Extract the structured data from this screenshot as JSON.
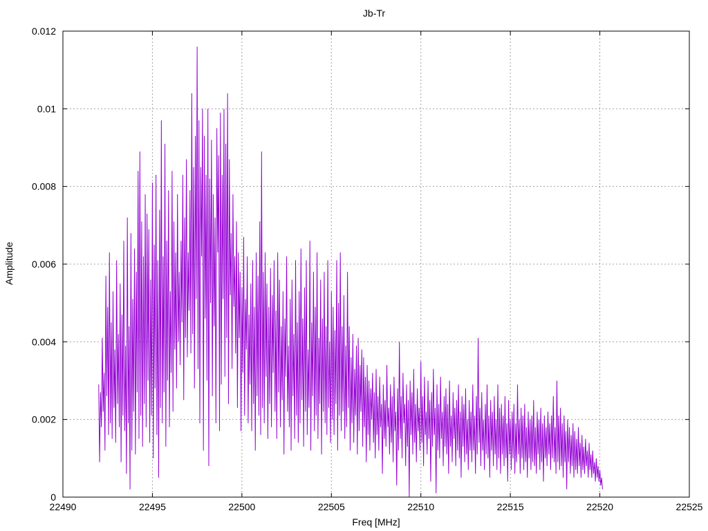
{
  "chart_data": {
    "type": "line",
    "title": "Jb-Tr",
    "xlabel": "Freq [MHz]",
    "ylabel": "Amplitude",
    "xlim": [
      22490,
      22525
    ],
    "ylim": [
      0,
      0.012
    ],
    "xticks": [
      22490,
      22495,
      22500,
      22505,
      22510,
      22515,
      22520,
      22525
    ],
    "yticks": [
      0,
      0.002,
      0.004,
      0.006,
      0.008,
      0.01,
      0.012
    ],
    "xtick_labels": [
      "22490",
      "22495",
      "22500",
      "22505",
      "22510",
      "22515",
      "22520",
      "22525"
    ],
    "ytick_labels": [
      "0",
      "0.002",
      "0.004",
      "0.006",
      "0.008",
      "0.01",
      "0.012"
    ],
    "grid": true,
    "legend": "none",
    "series_color": "#9400d3",
    "x_start": 22492.0,
    "x_step": 0.05,
    "series": [
      {
        "values": [
          0.0029,
          0.0009,
          0.0027,
          0.0018,
          0.0041,
          0.0022,
          0.0032,
          0.0012,
          0.0057,
          0.0026,
          0.0049,
          0.0016,
          0.0063,
          0.0019,
          0.0045,
          0.0015,
          0.0053,
          0.0023,
          0.0038,
          0.0014,
          0.0061,
          0.0024,
          0.0042,
          0.0018,
          0.0055,
          0.0009,
          0.0047,
          0.0021,
          0.0066,
          0.0017,
          0.0039,
          0.0006,
          0.0072,
          0.0019,
          0.0044,
          0.0002,
          0.0068,
          0.0012,
          0.0051,
          0.0022,
          0.0064,
          0.0011,
          0.0058,
          0.0027,
          0.0084,
          0.0015,
          0.0089,
          0.0021,
          0.0071,
          0.0013,
          0.0062,
          0.0024,
          0.0078,
          0.0018,
          0.0073,
          0.003,
          0.0069,
          0.0014,
          0.0056,
          0.0021,
          0.0081,
          0.001,
          0.0065,
          0.0028,
          0.0083,
          0.0016,
          0.0061,
          0.0005,
          0.0074,
          0.0023,
          0.0097,
          0.0019,
          0.0062,
          0.0027,
          0.0091,
          0.0013,
          0.0066,
          0.003,
          0.0079,
          0.0018,
          0.0053,
          0.0032,
          0.0084,
          0.0022,
          0.0071,
          0.0038,
          0.0063,
          0.0028,
          0.0078,
          0.004,
          0.0058,
          0.0034,
          0.0066,
          0.0045,
          0.0083,
          0.0025,
          0.0072,
          0.0041,
          0.0087,
          0.0036,
          0.0063,
          0.0048,
          0.0079,
          0.0037,
          0.0104,
          0.0042,
          0.0085,
          0.0028,
          0.0093,
          0.0051,
          0.0116,
          0.0033,
          0.0097,
          0.0019,
          0.0085,
          0.0062,
          0.01,
          0.0012,
          0.0093,
          0.0046,
          0.0083,
          0.003,
          0.01,
          0.0008,
          0.0082,
          0.005,
          0.0092,
          0.0026,
          0.0078,
          0.0044,
          0.0072,
          0.0019,
          0.0095,
          0.0063,
          0.0088,
          0.0017,
          0.0099,
          0.0029,
          0.0083,
          0.0051,
          0.01,
          0.0031,
          0.0091,
          0.0041,
          0.0104,
          0.0024,
          0.0087,
          0.0052,
          0.0068,
          0.0033,
          0.0078,
          0.0049,
          0.0062,
          0.0037,
          0.0071,
          0.0023,
          0.0063,
          0.0041,
          0.0058,
          0.0017,
          0.0054,
          0.0032,
          0.0067,
          0.0021,
          0.0051,
          0.0038,
          0.0062,
          0.0019,
          0.0047,
          0.0029,
          0.0055,
          0.0017,
          0.0061,
          0.0024,
          0.0049,
          0.0012,
          0.0063,
          0.0026,
          0.0057,
          0.0021,
          0.0071,
          0.0016,
          0.0089,
          0.0023,
          0.0058,
          0.0019,
          0.0063,
          0.0031,
          0.0055,
          0.0015,
          0.0049,
          0.0024,
          0.0059,
          0.0018,
          0.0052,
          0.0032,
          0.0061,
          0.0022,
          0.0048,
          0.0015,
          0.0063,
          0.0027,
          0.0056,
          0.0018,
          0.0044,
          0.0025,
          0.0053,
          0.0011,
          0.0046,
          0.0031,
          0.0062,
          0.0022,
          0.0039,
          0.0018,
          0.0051,
          0.0012,
          0.0056,
          0.0026,
          0.0042,
          0.0015,
          0.0061,
          0.0021,
          0.0045,
          0.0014,
          0.0053,
          0.0019,
          0.0064,
          0.0025,
          0.0046,
          0.0013,
          0.0054,
          0.0022,
          0.0061,
          0.0016,
          0.0038,
          0.0023,
          0.0066,
          0.0012,
          0.0045,
          0.0026,
          0.0058,
          0.0017,
          0.0049,
          0.0021,
          0.0063,
          0.0015,
          0.0041,
          0.0024,
          0.0056,
          0.0011,
          0.0046,
          0.0022,
          0.0058,
          0.0019,
          0.0044,
          0.0016,
          0.0061,
          0.0023,
          0.004,
          0.0014,
          0.0053,
          0.002,
          0.0049,
          0.0016,
          0.0043,
          0.0024,
          0.0061,
          0.0012,
          0.005,
          0.0021,
          0.0063,
          0.0017,
          0.0044,
          0.0022,
          0.0052,
          0.0015,
          0.0039,
          0.0018,
          0.0058,
          0.0023,
          0.0044,
          0.0012,
          0.0036,
          0.0019,
          0.0042,
          0.0014,
          0.0033,
          0.0021,
          0.0039,
          0.0011,
          0.0041,
          0.0017,
          0.0034,
          0.0022,
          0.0038,
          0.0013,
          0.0036,
          0.0018,
          0.0031,
          0.0009,
          0.0034,
          0.0016,
          0.003,
          0.0012,
          0.0028,
          0.002,
          0.0032,
          0.0014,
          0.0027,
          0.001,
          0.0033,
          0.0016,
          0.0026,
          0.0012,
          0.0031,
          0.0018,
          0.0024,
          0.0006,
          0.0029,
          0.0015,
          0.0025,
          0.0013,
          0.0034,
          0.0018,
          0.0023,
          0.0011,
          0.0029,
          0.0014,
          0.0026,
          0.0009,
          0.0031,
          0.0017,
          0.0022,
          0.0003,
          0.0028,
          0.0012,
          0.004,
          0.0015,
          0.0026,
          0.001,
          0.0032,
          0.0019,
          0.0024,
          0.0008,
          0.0029,
          0.0013,
          0.0025,
          0.0,
          0.003,
          0.0016,
          0.0027,
          0.0011,
          0.0033,
          0.0014,
          0.0024,
          0.0009,
          0.0028,
          0.0017,
          0.0023,
          0.0012,
          0.0035,
          0.0014,
          0.0026,
          0.0008,
          0.0031,
          0.0016,
          0.0022,
          0.0011,
          0.003,
          0.0015,
          0.0025,
          0.0004,
          0.0027,
          0.0013,
          0.0033,
          0.0016,
          0.0023,
          0.0001,
          0.0029,
          0.0012,
          0.0024,
          0.001,
          0.0031,
          0.0015,
          0.0022,
          0.0008,
          0.0026,
          0.0013,
          0.0028,
          0.0011,
          0.0024,
          0.0006,
          0.003,
          0.0013,
          0.0021,
          0.0009,
          0.0027,
          0.0015,
          0.0023,
          0.0008,
          0.0025,
          0.0012,
          0.0029,
          0.001,
          0.0022,
          0.0005,
          0.0026,
          0.0013,
          0.0024,
          0.0009,
          0.0028,
          0.0011,
          0.002,
          0.0007,
          0.0025,
          0.0012,
          0.0022,
          0.0009,
          0.0029,
          0.0012,
          0.0021,
          0.0006,
          0.0026,
          0.0011,
          0.0041,
          0.0014,
          0.0023,
          0.0008,
          0.0027,
          0.0012,
          0.002,
          0.0007,
          0.0024,
          0.0011,
          0.0029,
          0.001,
          0.0021,
          0.0005,
          0.0025,
          0.0012,
          0.0022,
          0.0008,
          0.0026,
          0.0011,
          0.002,
          0.0007,
          0.0029,
          0.001,
          0.0023,
          0.0006,
          0.0024,
          0.0011,
          0.0021,
          0.0008,
          0.0026,
          0.001,
          0.0019,
          0.0004,
          0.0025,
          0.0011,
          0.002,
          0.0007,
          0.0022,
          0.001,
          0.0024,
          0.0006,
          0.0019,
          0.0009,
          0.0029,
          0.0011,
          0.002,
          0.0006,
          0.0023,
          0.001,
          0.0021,
          0.0007,
          0.0024,
          0.0009,
          0.0018,
          0.0005,
          0.0022,
          0.001,
          0.002,
          0.0007,
          0.0021,
          0.0009,
          0.0025,
          0.0008,
          0.0018,
          0.0006,
          0.0022,
          0.0011,
          0.002,
          0.0007,
          0.0023,
          0.0009,
          0.0019,
          0.0004,
          0.0021,
          0.001,
          0.0018,
          0.0008,
          0.0022,
          0.0011,
          0.0019,
          0.0007,
          0.0021,
          0.001,
          0.0026,
          0.0009,
          0.0018,
          0.0006,
          0.003,
          0.0009,
          0.0021,
          0.0007,
          0.0023,
          0.0008,
          0.0019,
          0.0005,
          0.0021,
          0.0009,
          0.0017,
          0.0002,
          0.002,
          0.0009,
          0.0018,
          0.0006,
          0.0016,
          0.0008,
          0.0019,
          0.0005,
          0.0017,
          0.0007,
          0.0015,
          0.0006,
          0.0018,
          0.0008,
          0.0014,
          0.0005,
          0.0016,
          0.0007,
          0.0013,
          0.0006,
          0.0015,
          0.0008,
          0.0012,
          0.0005,
          0.0014,
          0.0007,
          0.0011,
          0.0005,
          0.0012,
          0.0006,
          0.0009,
          0.0004,
          0.001,
          0.0005,
          0.0008,
          0.0004,
          0.0007,
          0.0003,
          0.0005,
          0.0002
        ]
      }
    ]
  }
}
